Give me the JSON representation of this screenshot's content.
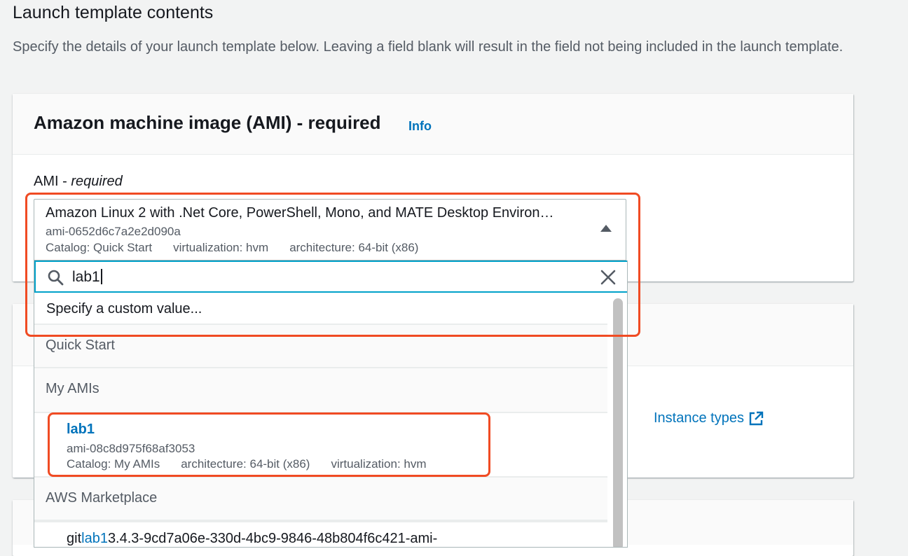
{
  "page": {
    "title": "Launch template contents",
    "description": "Specify the details of your launch template below. Leaving a field blank will result in the field not being included in the launch template."
  },
  "ami_panel": {
    "title": "Amazon machine image (AMI) - required",
    "info_link": "Info",
    "field_label": "AMI - ",
    "field_label_required": "required"
  },
  "selected_ami": {
    "name": "Amazon Linux 2 with .Net Core, PowerShell, Mono, and MATE Desktop Environ…",
    "id": "ami-0652d6c7a2e2d090a",
    "tags": [
      "Catalog: Quick Start",
      "virtualization: hvm",
      "architecture: 64-bit (x86)"
    ]
  },
  "search": {
    "value": "lab1",
    "icon": "search-icon",
    "clear_icon": "close-icon"
  },
  "dropdown": {
    "custom_value": "Specify a custom value...",
    "groups": {
      "quick_start": "Quick Start",
      "my_amis": "My AMIs",
      "marketplace": "AWS Marketplace"
    },
    "my_ami_option": {
      "name": "lab1",
      "id": "ami-08c8d975f68af3053",
      "tags": [
        "Catalog: My AMIs",
        "architecture: 64-bit (x86)",
        "virtualization: hvm"
      ]
    },
    "marketplace_option": {
      "prefix": "git",
      "match": "lab1",
      "suffix": "3.4.3-9cd7a06e-330d-4bc9-9846-48b804f6c421-ami-"
    }
  },
  "instance_panel": {
    "instance_types_link": "Instance types",
    "external_icon": "external-link-icon"
  },
  "colors": {
    "accent_link": "#0073bb",
    "focus_border": "#00a1c9",
    "annotation_red": "#f04b23"
  }
}
